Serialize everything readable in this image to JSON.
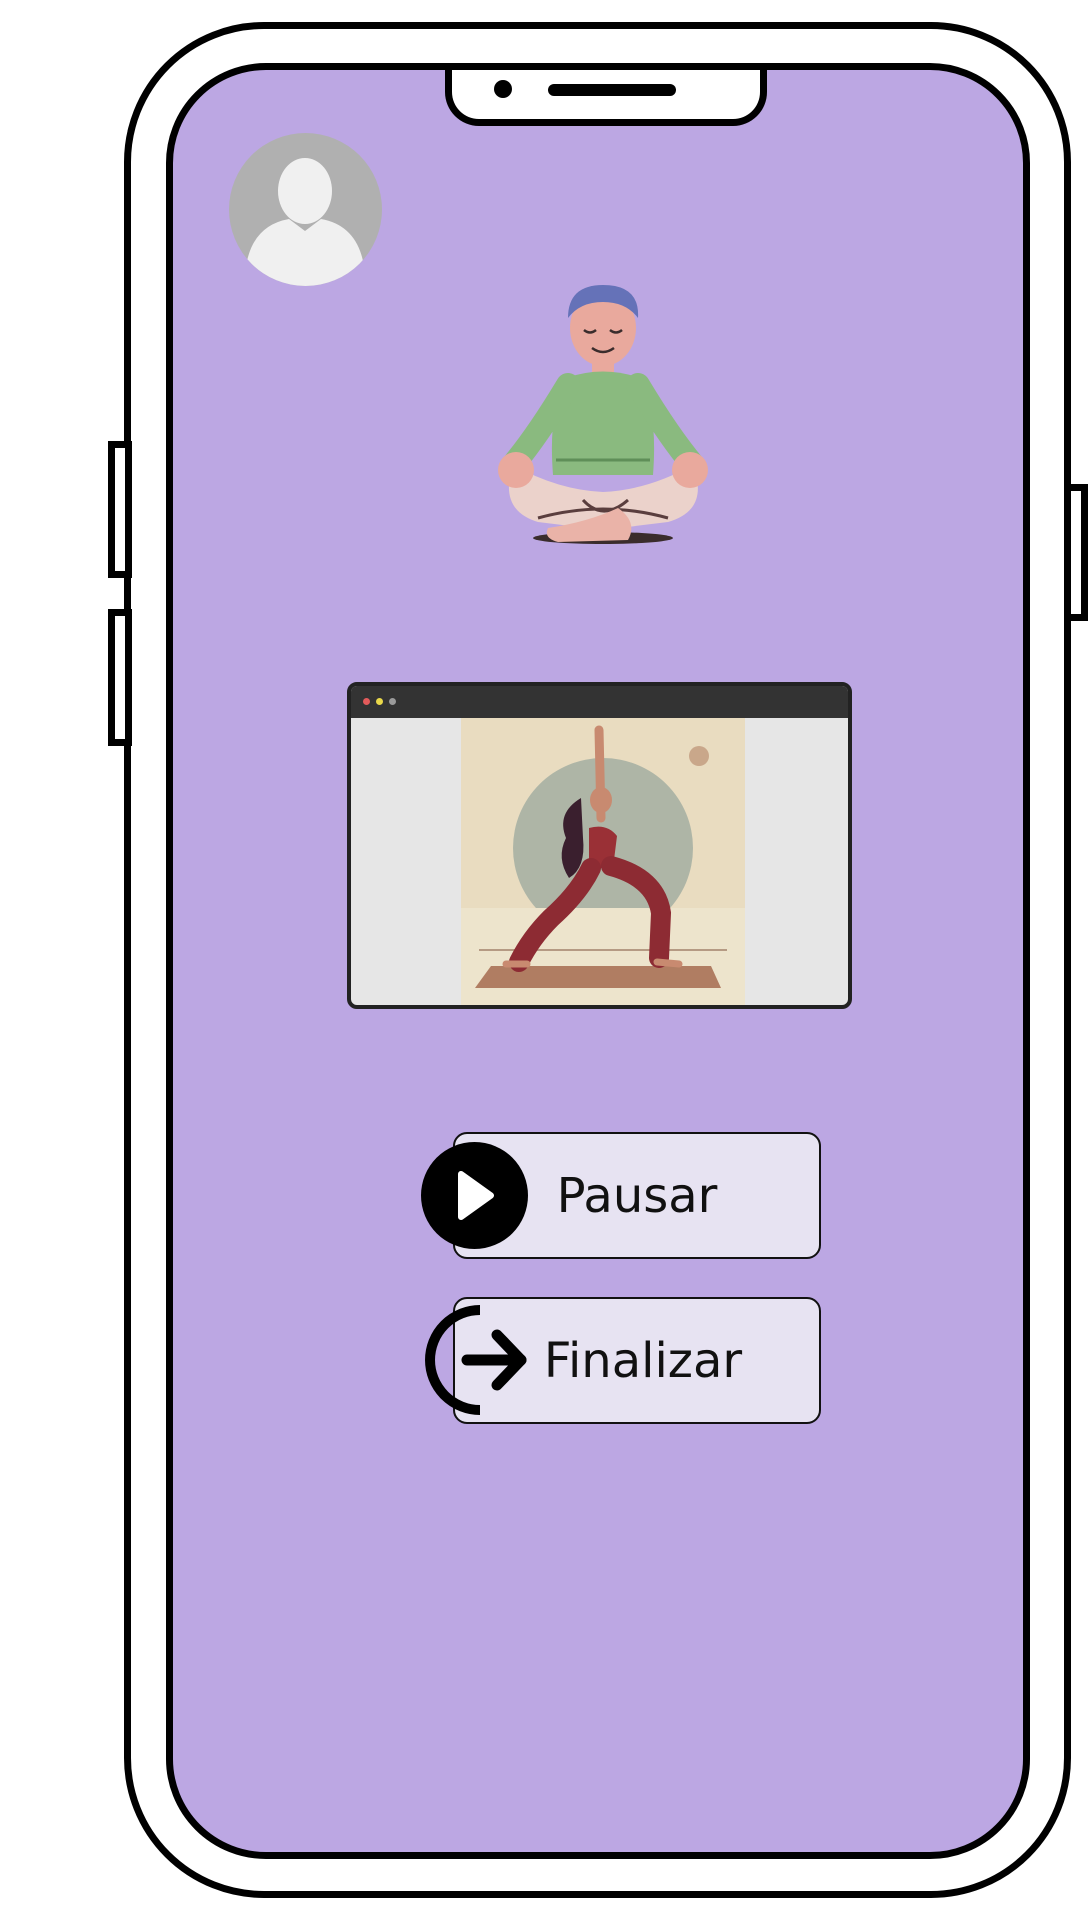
{
  "profile": {
    "avatar_icon": "user-avatar-icon"
  },
  "illustration": {
    "icon": "meditating-person-illustration"
  },
  "video": {
    "thumbnail_icon": "yoga-warrior-pose-illustration"
  },
  "buttons": {
    "pause_label": "Pausar",
    "pause_icon": "play-icon",
    "finish_label": "Finalizar",
    "finish_icon": "exit-arrow-icon"
  },
  "colors": {
    "screen_background": "#bca7e3",
    "button_background": "#e7e3f2",
    "frame": "#000000"
  }
}
